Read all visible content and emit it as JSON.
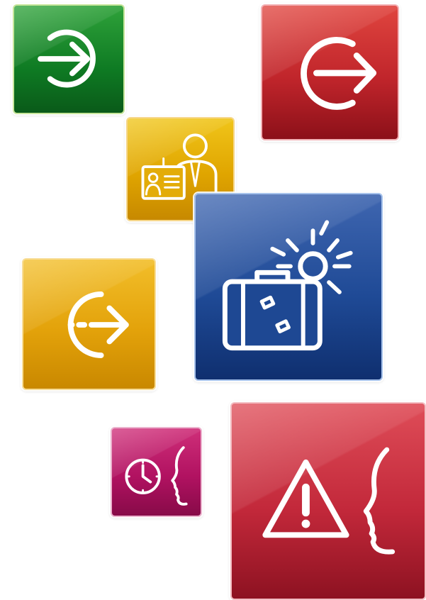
{
  "tiles": [
    {
      "name": "check-in",
      "icon": "sign-in-icon",
      "color": "#0e7a23"
    },
    {
      "name": "check-out",
      "icon": "sign-out-icon",
      "color": "#c0252b"
    },
    {
      "name": "visitor",
      "icon": "visitor-badge-icon",
      "color": "#e0a500"
    },
    {
      "name": "vacation",
      "icon": "suitcase-sun-icon",
      "color": "#1f4a96"
    },
    {
      "name": "exit",
      "icon": "dashed-exit-icon",
      "color": "#e3a20a"
    },
    {
      "name": "late",
      "icon": "clock-face-icon",
      "color": "#b11261"
    },
    {
      "name": "alert",
      "icon": "warning-face-icon",
      "color": "#c2283a"
    }
  ]
}
